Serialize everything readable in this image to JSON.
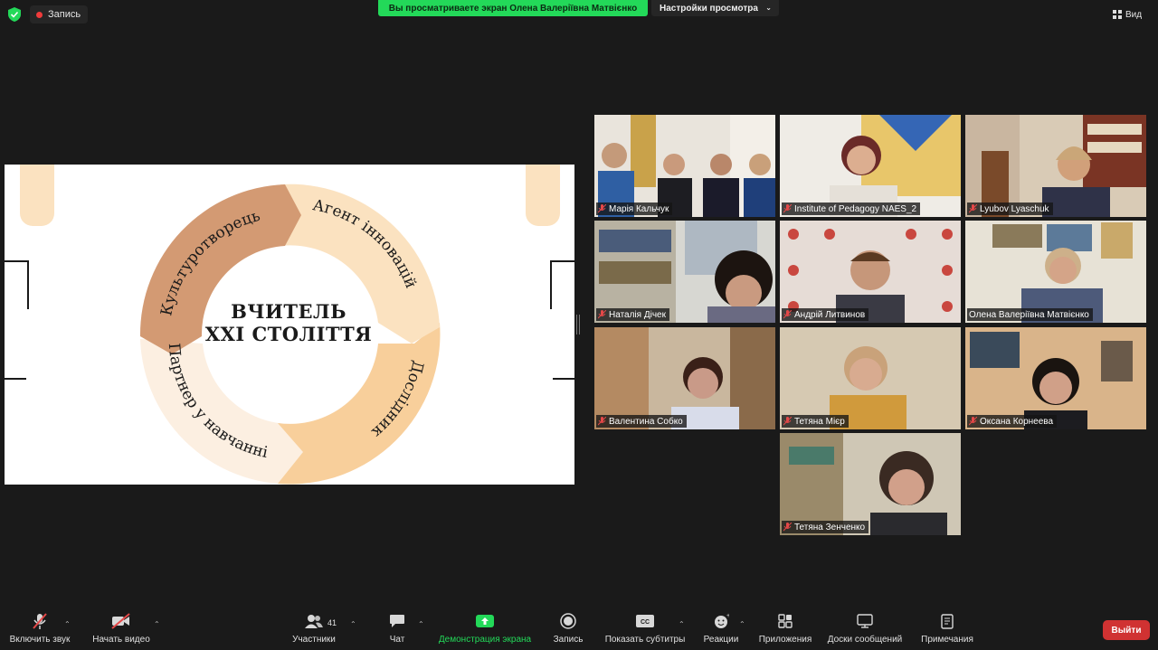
{
  "top": {
    "record_label": "Запись",
    "share_banner": "Вы просматриваете экран Олена Валеріївна Матвієнко",
    "view_options": "Настройки просмотра",
    "view_button": "Вид"
  },
  "slide": {
    "title_line1": "ВЧИТЕЛЬ",
    "title_line2": "XXI СТОЛІТТЯ",
    "segments": [
      "Культуротворець",
      "Агент інновацій",
      "Дослідник",
      "Партнер у навчанні"
    ],
    "colors": {
      "segment1": "#d39a73",
      "segment2": "#fbe2c0",
      "segment3": "#f8cf9b",
      "segment4": "#fcefe1"
    }
  },
  "participants": [
    {
      "name": "Марія Кальчук"
    },
    {
      "name": "Institute of Pedagogy NAES_2"
    },
    {
      "name": "Lyubov Lyaschuk"
    },
    {
      "name": "Наталія Дічек"
    },
    {
      "name": "Андрій Литвинов"
    },
    {
      "name": "Олена Валеріївна Матвієнко",
      "active": true
    },
    {
      "name": "Валентина Собко"
    },
    {
      "name": "Тетяна Мієр"
    },
    {
      "name": "Оксана Корнеева"
    },
    {
      "name": "Тетяна Зенченко"
    }
  ],
  "toolbar": {
    "mute": "Включить звук",
    "video": "Начать видео",
    "participants": "Участники",
    "participants_count": "41",
    "chat": "Чат",
    "share": "Демонстрация экрана",
    "record": "Запись",
    "captions": "Показать субтитры",
    "reactions": "Реакции",
    "apps": "Приложения",
    "whiteboards": "Доски сообщений",
    "notes": "Примечания",
    "leave": "Выйти"
  },
  "colors": {
    "accent_green": "#23d959",
    "leave_red": "#d03232",
    "active_speaker": "#d8e57c"
  }
}
